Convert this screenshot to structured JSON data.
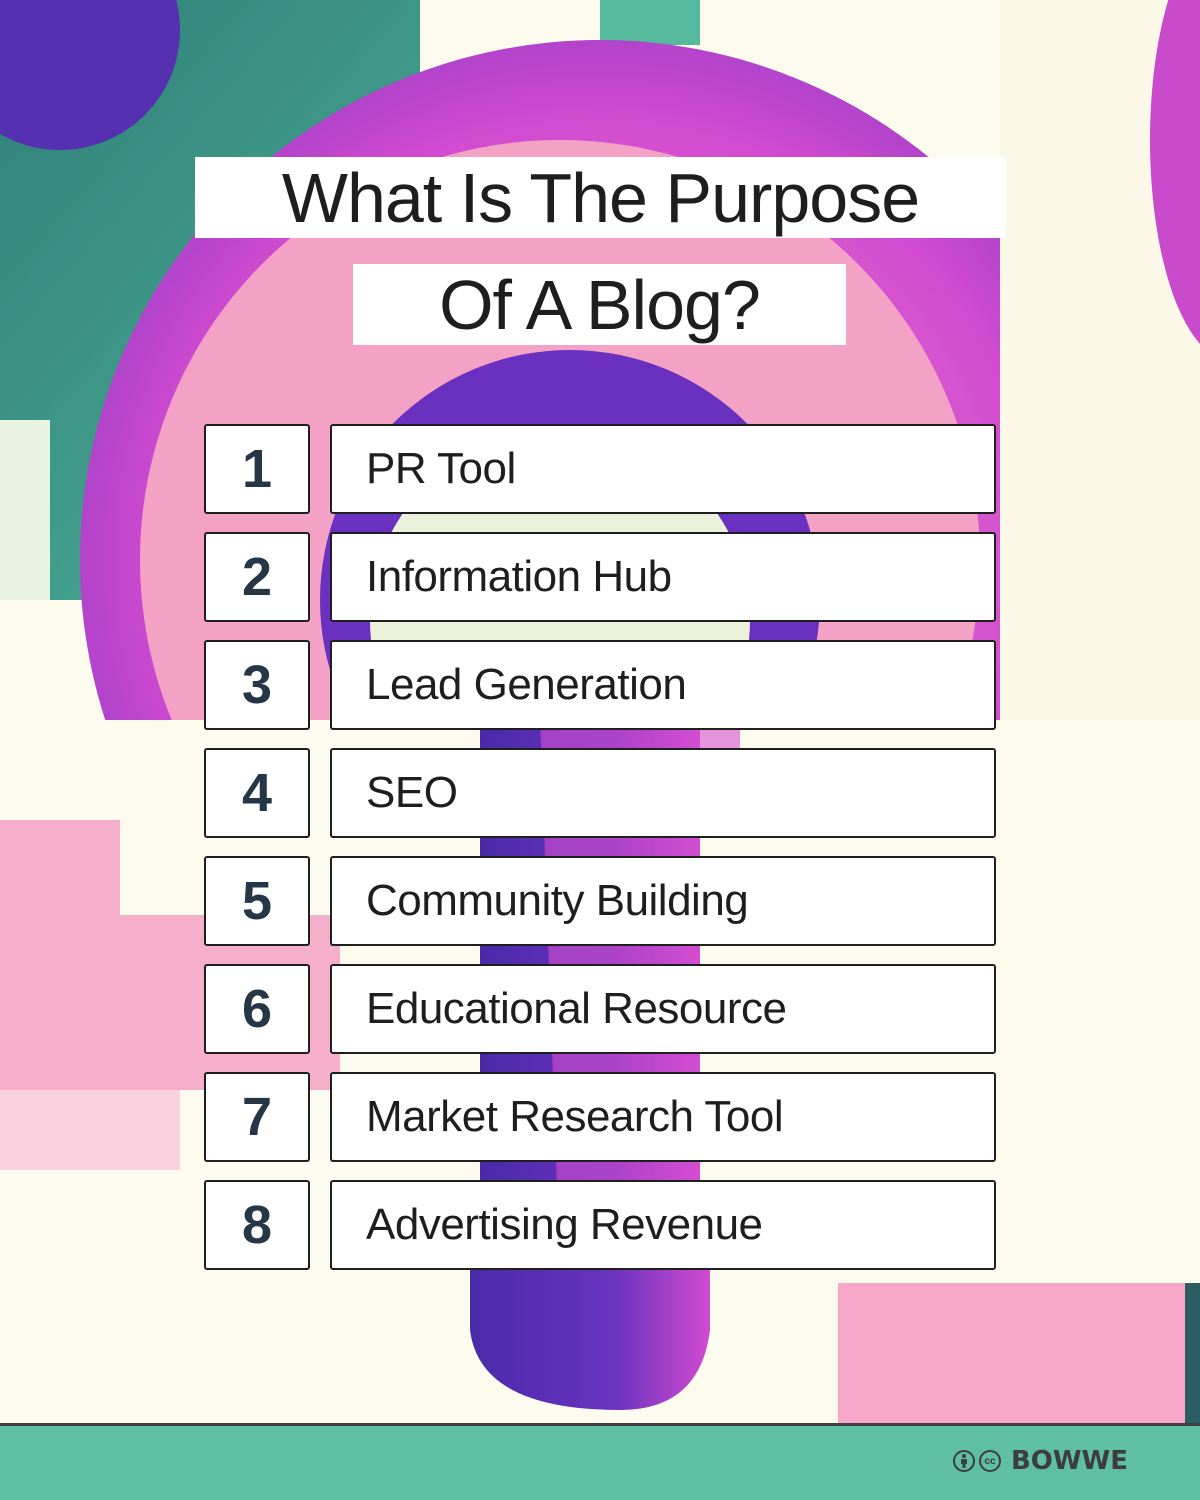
{
  "title": {
    "line1": "What Is The Purpose",
    "line2": "Of A Blog?"
  },
  "items": [
    {
      "number": "1",
      "label": "PR Tool"
    },
    {
      "number": "2",
      "label": "Information Hub"
    },
    {
      "number": "3",
      "label": "Lead Generation"
    },
    {
      "number": "4",
      "label": "SEO"
    },
    {
      "number": "5",
      "label": "Community Building"
    },
    {
      "number": "6",
      "label": "Educational Resource"
    },
    {
      "number": "7",
      "label": "Market Research Tool"
    },
    {
      "number": "8",
      "label": "Advertising Revenue"
    }
  ],
  "footer": {
    "attribution_icon": "person-icon",
    "license_icon": "cc-icon",
    "license_text": "cc",
    "brand": "BOWWE"
  },
  "colors": {
    "background": "#fdfaee",
    "teal": "#5fbfa3",
    "magenta": "#d84fd0",
    "pink": "#f6a7c8",
    "purple": "#5b2fb0",
    "number_text": "#253746",
    "text": "#1e1e1e"
  }
}
